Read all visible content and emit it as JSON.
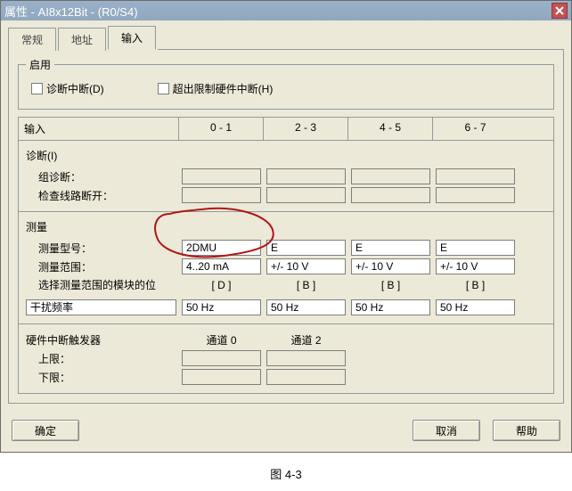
{
  "titlebar": {
    "text": "属性 - AI8x12Bit - (R0/S4)"
  },
  "tabs": {
    "t0": "常规",
    "t1": "地址",
    "t2": "输入"
  },
  "enable": {
    "legend": "启用",
    "diag": "诊断中断(D)",
    "limit": "超出限制硬件中断(H)"
  },
  "headers": {
    "input": "输入",
    "c01": "0 - 1",
    "c23": "2 - 3",
    "c45": "4 - 5",
    "c67": "6 - 7"
  },
  "diag": {
    "title": "诊断(I)",
    "group": "组诊断：",
    "wire": "检查线路断开："
  },
  "meas": {
    "title": "测量",
    "type_label": "测量型号：",
    "range_label": "测量范围：",
    "bits_label": "选择测量范围的模块的位",
    "type": {
      "c0": "2DMU",
      "c1": "E",
      "c2": "E",
      "c3": "E"
    },
    "range": {
      "c0": "4..20 mA",
      "c1": "+/- 10 V",
      "c2": "+/- 10 V",
      "c3": "+/- 10 V"
    },
    "bits": {
      "c0": "[ D ]",
      "c1": "[ B ]",
      "c2": "[ B ]",
      "c3": "[ B ]"
    },
    "noise_label": "干扰频率",
    "noise": {
      "c0": "50 Hz",
      "c1": "50 Hz",
      "c2": "50 Hz",
      "c3": "50 Hz"
    }
  },
  "hw": {
    "title": "硬件中断触发器",
    "ch0": "通道 0",
    "ch2": "通道 2",
    "upper": "上限：",
    "lower": "下限："
  },
  "buttons": {
    "ok": "确定",
    "cancel": "取消",
    "help": "帮助"
  },
  "caption": "图 4-3"
}
